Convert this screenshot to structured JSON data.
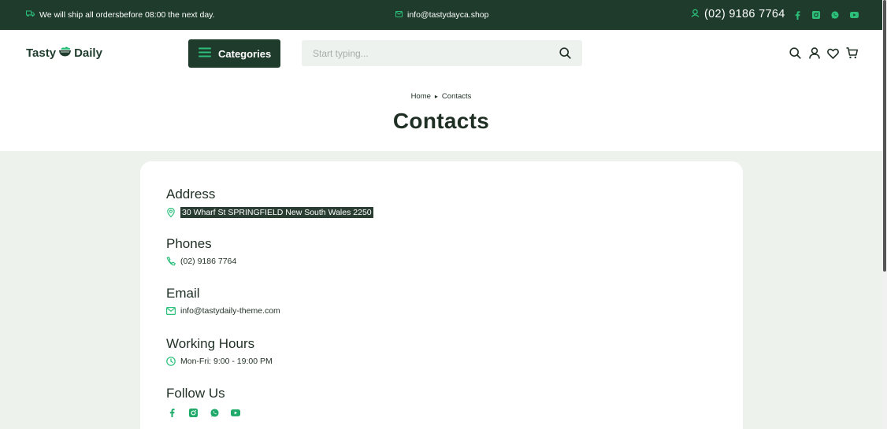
{
  "topbar": {
    "notice": "We will ship all ordersbefore 08:00 the next day.",
    "email": "info@tastydayca.shop",
    "phone": "(02) 9186 7764",
    "socials": [
      "facebook-icon",
      "instagram-icon",
      "whatsapp-icon",
      "youtube-icon"
    ]
  },
  "header": {
    "logo_left": "Tasty",
    "logo_right": "Daily",
    "categories_label": "Categories",
    "search_placeholder": "Start typing...",
    "icons": [
      "search-icon",
      "user-icon",
      "heart-icon",
      "cart-icon"
    ]
  },
  "breadcrumb": {
    "home": "Home",
    "current": "Contacts"
  },
  "page_title": "Contacts",
  "contact": {
    "address_heading": "Address",
    "address": "30 Wharf St SPRINGFIELD New South Wales 2250",
    "phones_heading": "Phones",
    "phone": "(02) 9186 7764",
    "email_heading": "Email",
    "email": "info@tastydaily-theme.com",
    "hours_heading": "Working Hours",
    "hours": "Mon-Fri: 9:00 - 19:00 PM",
    "follow_heading": "Follow Us",
    "follow_icons": [
      "facebook-icon",
      "instagram-icon",
      "whatsapp-icon",
      "youtube-icon"
    ]
  },
  "colors": {
    "brand_dark": "#1e3b2c",
    "accent_green": "#2bbf7a",
    "content_bg": "#edf2ec"
  }
}
